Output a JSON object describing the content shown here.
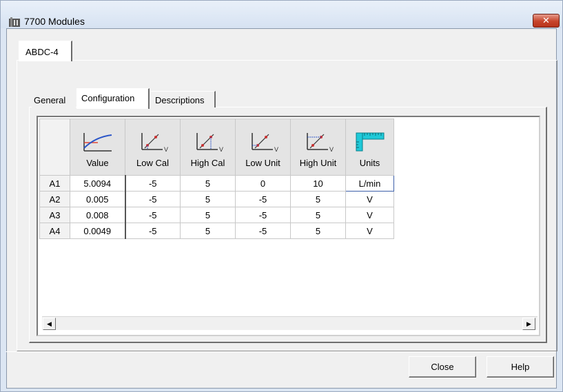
{
  "window": {
    "title": "7700 Modules",
    "close_glyph": "✕"
  },
  "outer_tab": {
    "label": "ABDC-4"
  },
  "tabs": [
    {
      "label": "General"
    },
    {
      "label": "Configuration"
    },
    {
      "label": "Descriptions"
    }
  ],
  "grid": {
    "columns": [
      {
        "label": "Value",
        "icon": "value-curve-icon"
      },
      {
        "label": "Low Cal",
        "icon": "low-cal-icon"
      },
      {
        "label": "High Cal",
        "icon": "high-cal-icon"
      },
      {
        "label": "Low Unit",
        "icon": "low-unit-icon"
      },
      {
        "label": "High Unit",
        "icon": "high-unit-icon"
      },
      {
        "label": "Units",
        "icon": "ruler-icon"
      }
    ],
    "rows": [
      {
        "id": "A1",
        "value": "5.0094",
        "low_cal": "-5",
        "high_cal": "5",
        "low_unit": "0",
        "high_unit": "10",
        "units": "L/min"
      },
      {
        "id": "A2",
        "value": "0.005",
        "low_cal": "-5",
        "high_cal": "5",
        "low_unit": "-5",
        "high_unit": "5",
        "units": "V"
      },
      {
        "id": "A3",
        "value": "0.008",
        "low_cal": "-5",
        "high_cal": "5",
        "low_unit": "-5",
        "high_unit": "5",
        "units": "V"
      },
      {
        "id": "A4",
        "value": "0.0049",
        "low_cal": "-5",
        "high_cal": "5",
        "low_unit": "-5",
        "high_unit": "5",
        "units": "V"
      }
    ],
    "icon_subscript": "V"
  },
  "buttons": {
    "close": "Close",
    "help": "Help"
  },
  "colors": {
    "accent_close": "#c7442b",
    "ruler": "#1fc9d8",
    "selection": "#3c5fa8"
  }
}
